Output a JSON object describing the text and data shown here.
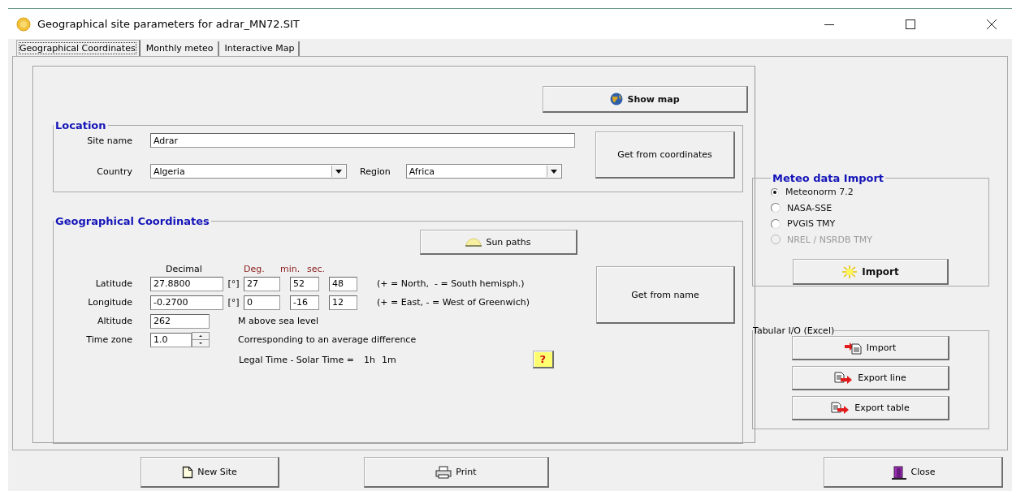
{
  "window": {
    "title": "Geographical site parameters for adrar_MN72.SIT"
  },
  "tabs": [
    {
      "label": "Geographical Coordinates",
      "selected": true
    },
    {
      "label": "Monthly meteo",
      "selected": false
    },
    {
      "label": "Interactive Map",
      "selected": false
    }
  ],
  "show_map_button": "Show map",
  "location": {
    "title": "Location",
    "site_name": {
      "label": "Site name",
      "value": "Adrar"
    },
    "country": {
      "label": "Country",
      "value": "Algeria"
    },
    "region": {
      "label": "Region",
      "value": "Africa"
    },
    "button": "Get from coordinates"
  },
  "coordinates": {
    "title": "Geographical Coordinates",
    "sun_paths_button": "Sun paths",
    "headers": {
      "decimal": "Decimal",
      "deg": "Deg.",
      "min": "min.",
      "sec": "sec."
    },
    "rows": [
      {
        "label": "Latitude",
        "decimal": "27.8800",
        "unit": "[°]",
        "deg": "27",
        "min": "52",
        "sec": "48",
        "note": "(+ = North,  - = South hemisph.)"
      },
      {
        "label": "Longitude",
        "decimal": "-0.2700",
        "unit": "[°]",
        "deg": "0",
        "min": "-16",
        "sec": "12",
        "note": "(+ = East, - = West of Greenwich)"
      }
    ],
    "altitude": {
      "label": "Altitude",
      "value": "262",
      "note": "M above sea level"
    },
    "time_zone": {
      "label": "Time zone",
      "value": "1.0",
      "note": "Corresponding to an average difference"
    },
    "legal_time": {
      "label": "Legal Time - Solar Time =",
      "hours": "1h",
      "minutes": "1m"
    },
    "help_button": "?",
    "get_from_name_button": "Get from name"
  },
  "meteo_import": {
    "title": "Meteo data Import",
    "options": [
      {
        "label": "Meteonorm 7.2",
        "selected": true,
        "disabled": false
      },
      {
        "label": "NASA-SSE",
        "selected": false,
        "disabled": false
      },
      {
        "label": "PVGIS TMY",
        "selected": false,
        "disabled": false
      },
      {
        "label": "NREL / NSRDB TMY",
        "selected": false,
        "disabled": true
      }
    ],
    "button": "Import"
  },
  "tabular_io": {
    "title": "Tabular I/O (Excel)",
    "buttons": [
      {
        "label": "Import",
        "kind": "import"
      },
      {
        "label": "Export line",
        "kind": "export"
      },
      {
        "label": "Export table",
        "kind": "export"
      }
    ]
  },
  "footer_buttons": [
    {
      "label": "New Site",
      "kind": "new"
    },
    {
      "label": "Print",
      "kind": "print"
    },
    {
      "label": "Close",
      "kind": "close"
    }
  ]
}
